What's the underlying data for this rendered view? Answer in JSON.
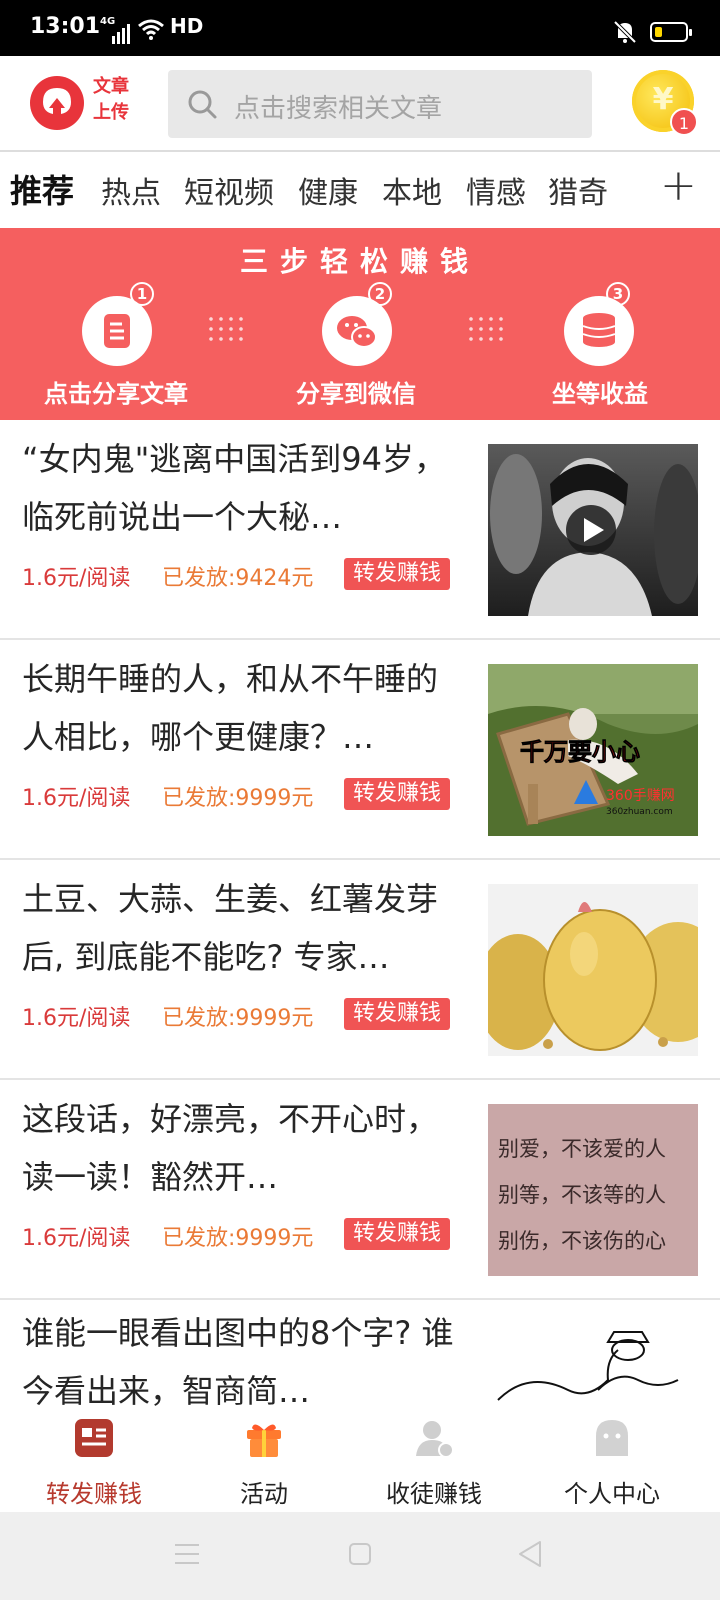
{
  "status_bar": {
    "time": "13:01",
    "signal_label": "4G",
    "network": "HD"
  },
  "header": {
    "logo_text": "文章上传",
    "search_placeholder": "点击搜索相关文章",
    "coin_symbol": "¥",
    "coin_badge": "1"
  },
  "tabs": [
    "推荐",
    "热点",
    "短视频",
    "健康",
    "本地",
    "情感",
    "猎奇"
  ],
  "banner": {
    "title": "三步轻松赚钱",
    "steps": [
      {
        "num": "1",
        "label": "点击分享文章",
        "icon": "document-icon"
      },
      {
        "num": "2",
        "label": "分享到微信",
        "icon": "wechat-icon"
      },
      {
        "num": "3",
        "label": "坐等收益",
        "icon": "coins-icon"
      }
    ]
  },
  "articles": [
    {
      "title": "“女内鬼\"逃离中国活到94岁，临死前说出一个大秘…",
      "price": "1.6元/阅读",
      "paid": "已发放:9424元",
      "share": "转发赚钱",
      "thumb": "old-portrait-video-thumbnail"
    },
    {
      "title": "长期午睡的人，和从不午睡的人相比，哪个更健康？…",
      "price": "1.6元/阅读",
      "paid": "已发放:9999元",
      "share": "转发赚钱",
      "thumb": "man-napping-chair-thumbnail",
      "thumb_caption": "千万要小心",
      "thumb_watermark": "360手赚网",
      "thumb_url": "360zhuan.com"
    },
    {
      "title": "土豆、大蒜、生姜、红薯发芽后, 到底能不能吃? 专家…",
      "price": "1.6元/阅读",
      "paid": "已发放:9999元",
      "share": "转发赚钱",
      "thumb": "potatoes-thumbnail"
    },
    {
      "title": "这段话，好漂亮，不开心时，读一读！豁然开…",
      "price": "1.6元/阅读",
      "paid": "已发放:9999元",
      "share": "转发赚钱",
      "thumb": "quote-text-thumbnail",
      "thumb_lines": [
        "别爱，不该爱的人",
        "别等，不该等的人",
        "别伤，不该伤的心"
      ]
    },
    {
      "title": "谁能一眼看出图中的8个字? 谁今看出来，智商简…",
      "thumb": "doodle-figure-thumbnail"
    }
  ],
  "bottom_nav": [
    {
      "label": "转发赚钱",
      "icon": "news-icon",
      "active": true
    },
    {
      "label": "活动",
      "icon": "gift-icon",
      "active": false
    },
    {
      "label": "收徒赚钱",
      "icon": "user-add-icon",
      "active": false
    },
    {
      "label": "个人中心",
      "icon": "ghost-profile-icon",
      "active": false
    }
  ],
  "colors": {
    "brand_red": "#e8343b",
    "banner_bg": "#f55f5f",
    "price_red": "#d93a3a",
    "paid_orange": "#ea7a36",
    "active_nav": "#b73a2e"
  }
}
